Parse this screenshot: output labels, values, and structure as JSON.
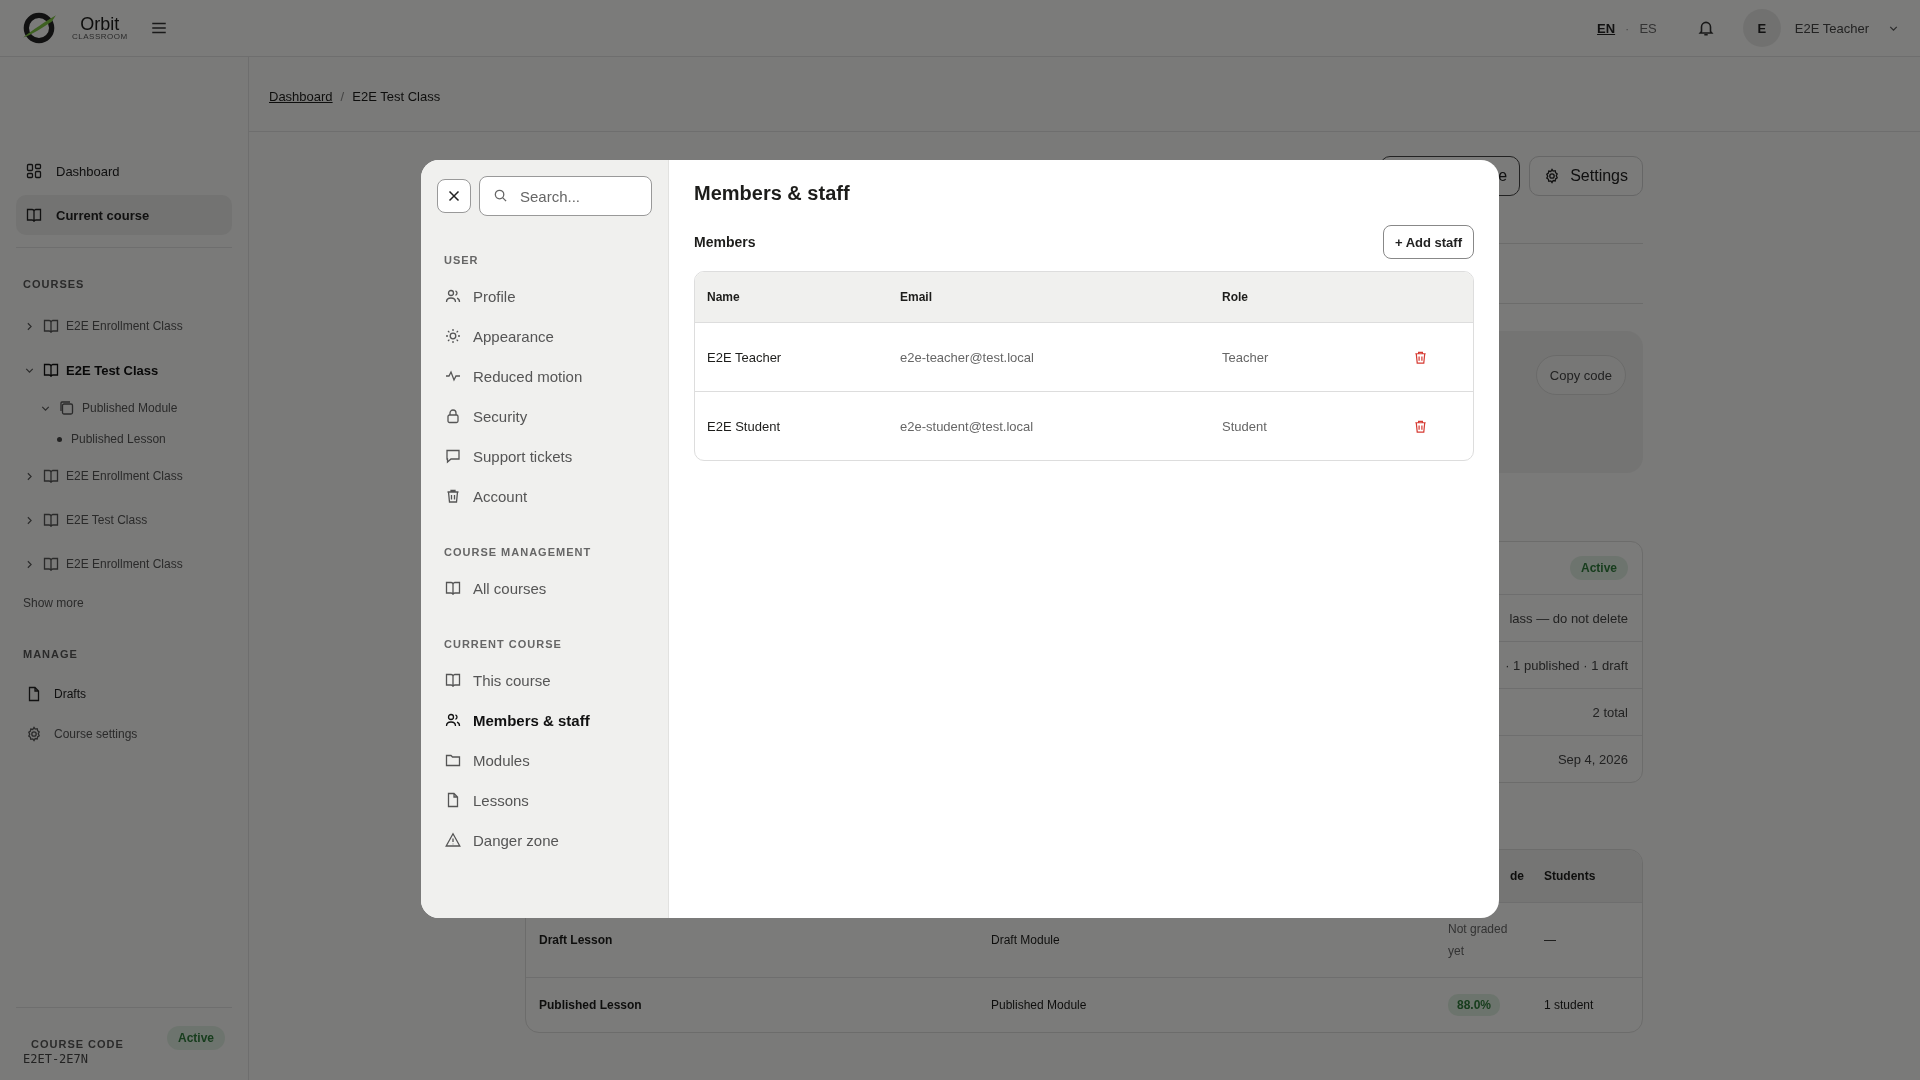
{
  "topbar": {
    "brand": "Orbit",
    "tagline": "CLASSROOM",
    "languages": [
      {
        "label": "EN",
        "selected": true
      },
      {
        "label": "ES",
        "selected": false
      }
    ],
    "language_separator": "·",
    "user": {
      "initial": "E",
      "name": "E2E Teacher"
    }
  },
  "breadcrumb": {
    "items": [
      {
        "label": "Dashboard",
        "link": true
      },
      {
        "label": "E2E Test Class",
        "link": false
      }
    ],
    "separator": "/"
  },
  "sidebar": {
    "nav": [
      {
        "label": "Dashboard",
        "selected": false
      },
      {
        "label": "Current course",
        "selected": true
      }
    ],
    "courses_heading": "COURSES",
    "courses": [
      {
        "kind": "course",
        "label": "E2E Enrollment Class",
        "expanded": false,
        "selected": false
      },
      {
        "kind": "course",
        "label": "E2E Test Class",
        "expanded": true,
        "selected": true,
        "children": [
          {
            "kind": "module",
            "label": "Published Module",
            "expanded": true,
            "selected": false,
            "children": [
              {
                "kind": "lesson",
                "label": "Published Lesson",
                "selected": false
              }
            ]
          }
        ]
      },
      {
        "kind": "course",
        "label": "E2E Enrollment Class",
        "expanded": false,
        "selected": false
      },
      {
        "kind": "course",
        "label": "E2E Test Class",
        "expanded": false,
        "selected": false
      },
      {
        "kind": "course",
        "label": "E2E Enrollment Class",
        "expanded": false,
        "selected": false
      }
    ],
    "show_more": "Show more",
    "manage_heading": "MANAGE",
    "manage": [
      {
        "label": "Drafts"
      },
      {
        "label": "Course settings"
      }
    ],
    "course_code": {
      "heading": "COURSE CODE",
      "status": "Active",
      "code": "E2ET-2E7N"
    }
  },
  "background": {
    "header_buttons": [
      {
        "label": "e"
      },
      {
        "label": "Settings"
      }
    ],
    "copy_button": "Copy code",
    "status_badge": "Active",
    "detail_rows": [
      "lass — do not delete",
      "· 1 published · 1 draft",
      "2 total",
      "Sep 4, 2026"
    ],
    "lessons_table": {
      "columns": [
        "",
        "",
        "de",
        "Students"
      ],
      "rows": [
        {
          "lesson": "Draft Lesson",
          "module": "Draft Module",
          "grade": "Not graded yet",
          "graded": false,
          "students": "—"
        },
        {
          "lesson": "Published Lesson",
          "module": "Published Module",
          "grade": "88.0%",
          "graded": true,
          "students": "1 student"
        }
      ]
    }
  },
  "modal": {
    "search": {
      "placeholder": "Search..."
    },
    "sections": [
      {
        "heading": "USER",
        "items": [
          {
            "label": "Profile",
            "selected": false
          },
          {
            "label": "Appearance",
            "selected": false
          },
          {
            "label": "Reduced motion",
            "selected": false
          },
          {
            "label": "Security",
            "selected": false
          },
          {
            "label": "Support tickets",
            "selected": false
          },
          {
            "label": "Account",
            "selected": false
          }
        ]
      },
      {
        "heading": "COURSE MANAGEMENT",
        "items": [
          {
            "label": "All courses",
            "selected": false
          }
        ]
      },
      {
        "heading": "CURRENT COURSE",
        "items": [
          {
            "label": "This course",
            "selected": false
          },
          {
            "label": "Members & staff",
            "selected": true
          },
          {
            "label": "Modules",
            "selected": false
          },
          {
            "label": "Lessons",
            "selected": false
          },
          {
            "label": "Danger zone",
            "selected": false
          }
        ]
      }
    ],
    "title": "Members & staff",
    "subtitle": "Members",
    "add_button": "+ Add staff",
    "table": {
      "columns": [
        "Name",
        "Email",
        "Role"
      ],
      "rows": [
        {
          "name": "E2E Teacher",
          "email": "e2e-teacher@test.local",
          "role": "Teacher"
        },
        {
          "name": "E2E Student",
          "email": "e2e-student@test.local",
          "role": "Student"
        }
      ]
    }
  }
}
